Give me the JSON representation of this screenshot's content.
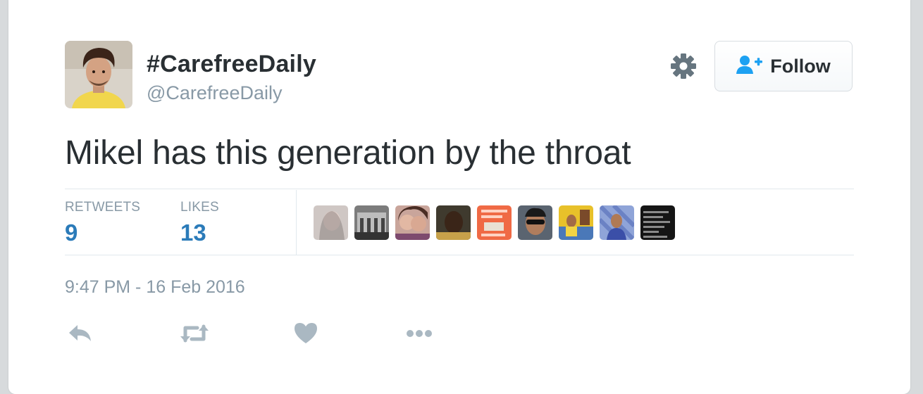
{
  "user": {
    "display_name": "#CarefreeDaily",
    "username": "@CarefreeDaily",
    "avatar_icon": "profile-photo"
  },
  "follow_button": {
    "label": "Follow",
    "icon": "add-user-icon"
  },
  "settings_icon": "gear-icon",
  "tweet": {
    "text": "Mikel has this generation by the throat"
  },
  "stats": {
    "retweets_label": "RETWEETS",
    "retweets_count": "9",
    "likes_label": "LIKES",
    "likes_count": "13"
  },
  "likers_count_shown": 9,
  "timestamp": "9:47 PM - 16 Feb 2016",
  "actions": [
    "reply-icon",
    "retweet-icon",
    "like-icon",
    "more-icon"
  ],
  "colors": {
    "accent": "#2b7bb9",
    "follow_icon": "#1da1f2",
    "muted": "#8899a6",
    "icon_gray": "#aab8c2",
    "text": "#292f33"
  }
}
